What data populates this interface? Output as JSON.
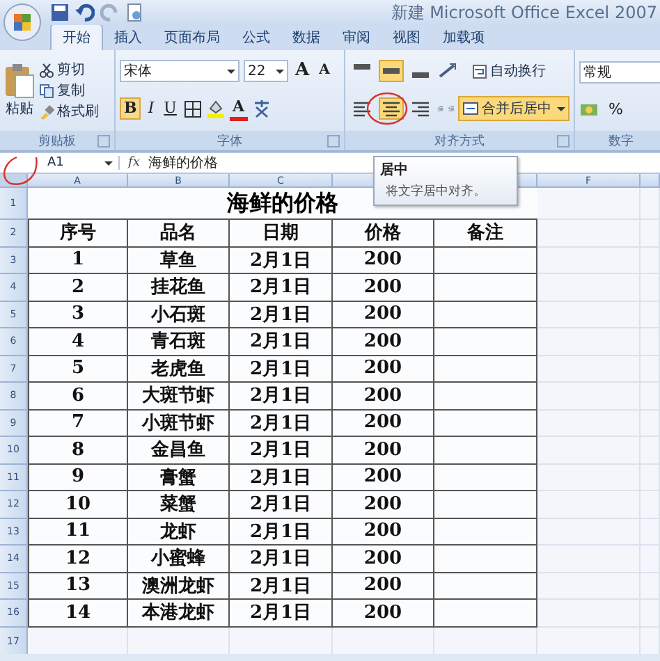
{
  "window": {
    "title": "新建 Microsoft Office Excel 2007"
  },
  "ribbon_tabs": [
    {
      "label": "开始",
      "selected": true
    },
    {
      "label": "插入",
      "selected": false
    },
    {
      "label": "页面布局",
      "selected": false
    },
    {
      "label": "公式",
      "selected": false
    },
    {
      "label": "数据",
      "selected": false
    },
    {
      "label": "审阅",
      "selected": false
    },
    {
      "label": "视图",
      "selected": false
    },
    {
      "label": "加载项",
      "selected": false
    }
  ],
  "clipboard": {
    "paste": "粘贴",
    "items": [
      {
        "kind": "cut",
        "label": "剪切"
      },
      {
        "kind": "copy",
        "label": "复制"
      },
      {
        "kind": "brush",
        "label": "格式刷"
      }
    ],
    "group_label": "剪贴板"
  },
  "font": {
    "name": "宋体",
    "size": "22",
    "grow": "A",
    "shrink": "A",
    "bold": "B",
    "italic": "I",
    "underline": "U",
    "color_letter": "A",
    "group_label": "字体"
  },
  "alignment": {
    "vertical": [
      {
        "kind": "top",
        "selected": false
      },
      {
        "kind": "middle",
        "selected": true
      },
      {
        "kind": "bottom",
        "selected": false
      }
    ],
    "horizontal": [
      {
        "kind": "left",
        "selected": false
      },
      {
        "kind": "center",
        "selected": true
      },
      {
        "kind": "right",
        "selected": false
      }
    ],
    "wrap": "自动换行",
    "merge": {
      "label": "合并后居中",
      "selected": true
    },
    "group_label": "对齐方式"
  },
  "number": {
    "format": "常规",
    "percent": "%",
    "group_label": "数字"
  },
  "formula_bar": {
    "cell": "A1",
    "function_label": "fx",
    "value": "海鲜的价格"
  },
  "tooltip": {
    "title": "居中",
    "text": "将文字居中对齐。"
  },
  "sheet": {
    "columns": [
      "A",
      "B",
      "C",
      "F"
    ],
    "title": "海鲜的价格",
    "header": [
      "序号",
      "品名",
      "日期",
      "价格",
      "备注"
    ],
    "rows": [
      {
        "cells": [
          "1",
          "草鱼",
          "2月1日",
          "200"
        ]
      },
      {
        "cells": [
          "2",
          "挂花鱼",
          "2月1日",
          "200"
        ]
      },
      {
        "cells": [
          "3",
          "小石斑",
          "2月1日",
          "200"
        ]
      },
      {
        "cells": [
          "4",
          "青石斑",
          "2月1日",
          "200"
        ]
      },
      {
        "cells": [
          "5",
          "老虎鱼",
          "2月1日",
          "200"
        ]
      },
      {
        "cells": [
          "6",
          "大斑节虾",
          "2月1日",
          "200"
        ]
      },
      {
        "cells": [
          "7",
          "小斑节虾",
          "2月1日",
          "200"
        ]
      },
      {
        "cells": [
          "8",
          "金昌鱼",
          "2月1日",
          "200"
        ]
      },
      {
        "cells": [
          "9",
          "膏蟹",
          "2月1日",
          "200"
        ]
      },
      {
        "cells": [
          "10",
          "菜蟹",
          "2月1日",
          "200"
        ]
      },
      {
        "cells": [
          "11",
          "龙虾",
          "2月1日",
          "200"
        ]
      },
      {
        "cells": [
          "12",
          "小蜜蜂",
          "2月1日",
          "200"
        ]
      },
      {
        "cells": [
          "13",
          "澳洲龙虾",
          "2月1日",
          "200"
        ]
      },
      {
        "cells": [
          "14",
          "本港龙虾",
          "2月1日",
          "200"
        ]
      }
    ],
    "row_numbers": [
      "1",
      "2",
      "3",
      "4",
      "5",
      "6",
      "7",
      "8",
      "9",
      "10",
      "11",
      "12",
      "13",
      "14",
      "15",
      "16",
      "17"
    ]
  }
}
